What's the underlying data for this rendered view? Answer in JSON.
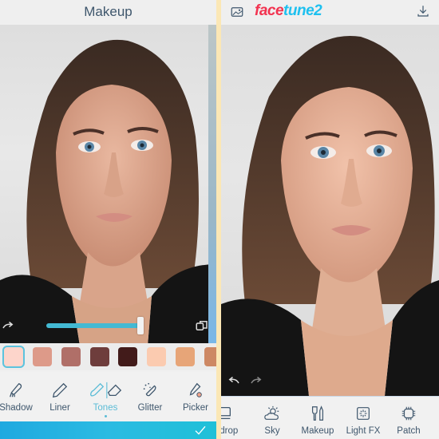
{
  "left": {
    "title": "Makeup",
    "slider": {
      "value_percent": 100
    },
    "swatches": [
      {
        "color": "#fdd5cb",
        "selected": true
      },
      {
        "color": "#dd9a89",
        "selected": false
      },
      {
        "color": "#b06f68",
        "selected": false
      },
      {
        "color": "#6e3d3c",
        "selected": false
      },
      {
        "color": "#421b1a",
        "selected": false
      },
      {
        "color": "#fbcbb0",
        "selected": false
      },
      {
        "color": "#e7a578",
        "selected": false
      },
      {
        "color": "#cd8864",
        "selected": false
      }
    ],
    "tools": [
      {
        "label": "Shadow",
        "icon": "brush-icon"
      },
      {
        "label": "Liner",
        "icon": "pencil-icon"
      },
      {
        "label": "Tones",
        "icon": "tones-eraser-icon",
        "active": true
      },
      {
        "label": "Glitter",
        "icon": "glitter-icon"
      },
      {
        "label": "Picker",
        "icon": "picker-icon"
      }
    ],
    "confirm_icon": "checkmark-icon"
  },
  "right": {
    "logo_part1": "face",
    "logo_part2": "tune2",
    "tools": [
      {
        "label": "ckdrop",
        "icon": "backdrop-icon"
      },
      {
        "label": "Sky",
        "icon": "sky-icon"
      },
      {
        "label": "Makeup",
        "icon": "makeup-icon"
      },
      {
        "label": "Light FX",
        "icon": "light-fx-icon"
      },
      {
        "label": "Patch",
        "icon": "patch-icon"
      }
    ]
  },
  "colors": {
    "accent": "#43b9d3",
    "text": "#3e566c",
    "logo_red": "#f23350",
    "logo_blue": "#1ec0ef"
  }
}
